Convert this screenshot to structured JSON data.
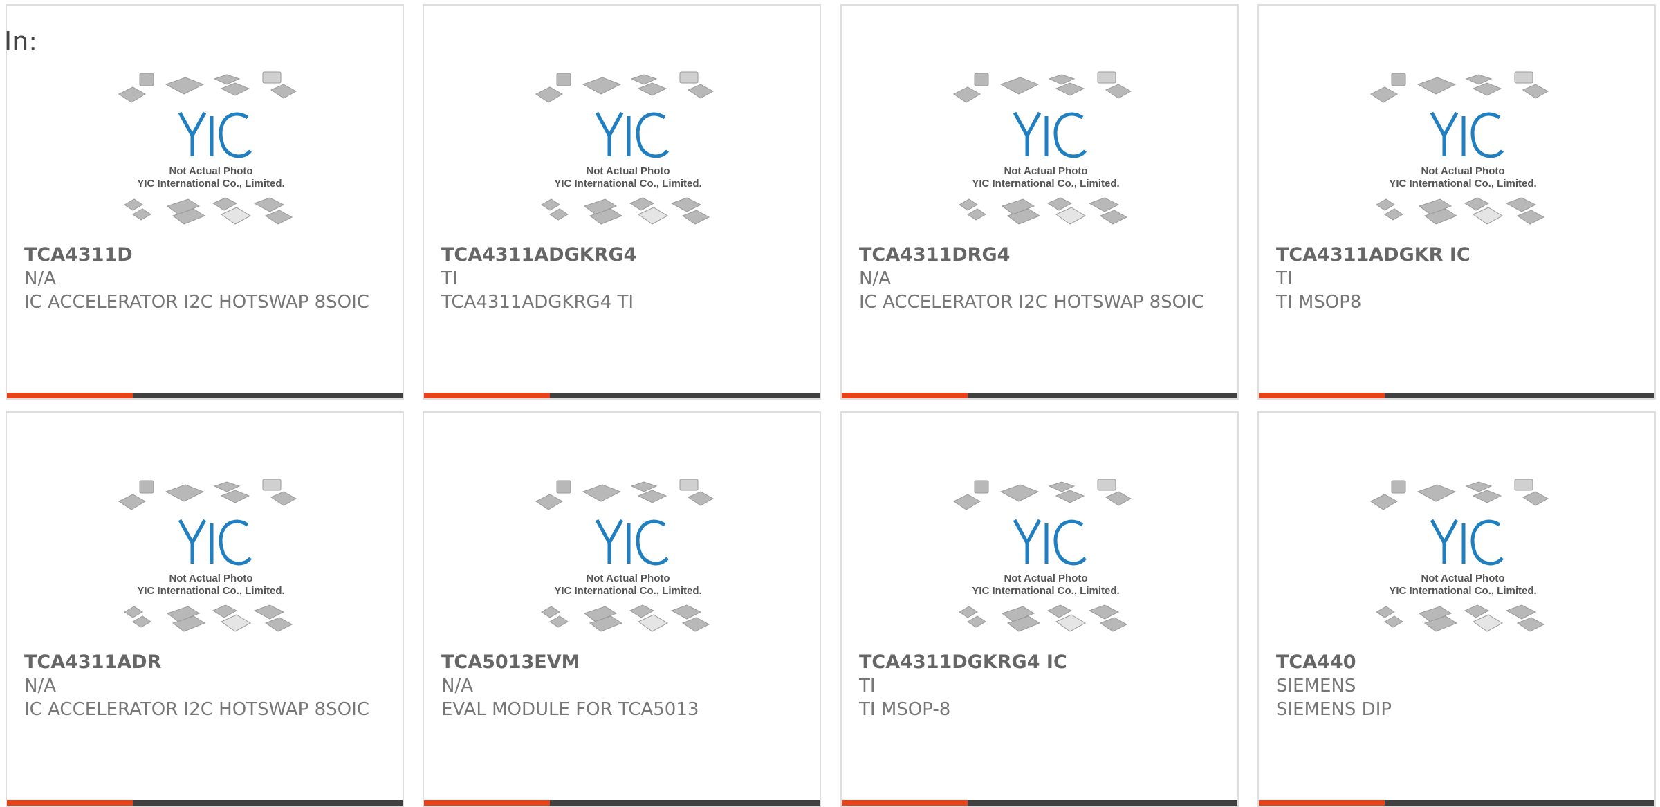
{
  "header": {
    "label": "In:"
  },
  "placeholder": {
    "line1": "Not Actual Photo",
    "line2": "YIC International Co., Limited."
  },
  "colors": {
    "accent": "#e8421a",
    "bar": "#404040",
    "logo": "#1f7fc0"
  },
  "products": [
    {
      "part_number": "TCA4311D",
      "manufacturer": "N/A",
      "description": "IC ACCELERATOR I2C HOTSWAP 8SOIC"
    },
    {
      "part_number": "TCA4311ADGKRG4",
      "manufacturer": "TI",
      "description": "TCA4311ADGKRG4 TI"
    },
    {
      "part_number": "TCA4311DRG4",
      "manufacturer": "N/A",
      "description": "IC ACCELERATOR I2C HOTSWAP 8SOIC"
    },
    {
      "part_number": "TCA4311ADGKR IC",
      "manufacturer": "TI",
      "description": "TI MSOP8"
    },
    {
      "part_number": "TCA4311ADR",
      "manufacturer": "N/A",
      "description": "IC ACCELERATOR I2C HOTSWAP 8SOIC"
    },
    {
      "part_number": "TCA5013EVM",
      "manufacturer": "N/A",
      "description": "EVAL MODULE FOR TCA5013"
    },
    {
      "part_number": "TCA4311DGKRG4 IC",
      "manufacturer": "TI",
      "description": "TI MSOP-8"
    },
    {
      "part_number": "TCA440",
      "manufacturer": "SIEMENS",
      "description": "SIEMENS DIP"
    }
  ]
}
